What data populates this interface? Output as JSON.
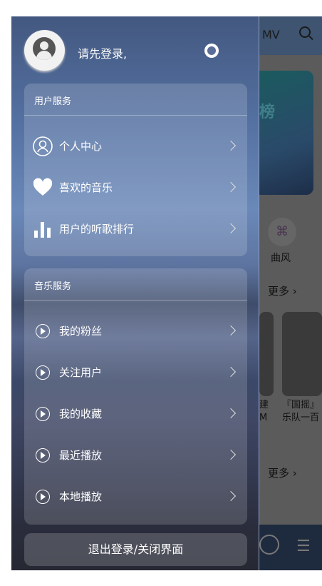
{
  "background": {
    "topbar": {
      "mv_label": "MV",
      "icon": "search-icon"
    },
    "quick": {
      "label": "曲风",
      "icon": "grid-icon"
    },
    "banner_text": "榜",
    "more_1": "更多 ›",
    "more_2": "更多 ›",
    "cards": [
      {
        "caption": "建\nM"
      },
      {
        "caption": "『国摇』\n乐队一百"
      }
    ]
  },
  "drawer": {
    "login_prompt": "请先登录,",
    "theme_icon": "brightness-icon",
    "user_services": {
      "title": "用户服务",
      "items": [
        {
          "label": "个人中心",
          "icon": "user-circle-icon"
        },
        {
          "label": "喜欢的音乐",
          "icon": "heart-icon"
        },
        {
          "label": "用户的听歌排行",
          "icon": "bar-chart-icon"
        }
      ]
    },
    "music_services": {
      "title": "音乐服务",
      "items": [
        {
          "label": "我的粉丝",
          "icon": "play-circle-icon"
        },
        {
          "label": "关注用户",
          "icon": "play-circle-icon"
        },
        {
          "label": "我的收藏",
          "icon": "play-circle-icon"
        },
        {
          "label": "最近播放",
          "icon": "play-circle-icon"
        },
        {
          "label": "本地播放",
          "icon": "play-circle-icon"
        }
      ]
    },
    "logout_label": "退出登录/关闭界面"
  }
}
